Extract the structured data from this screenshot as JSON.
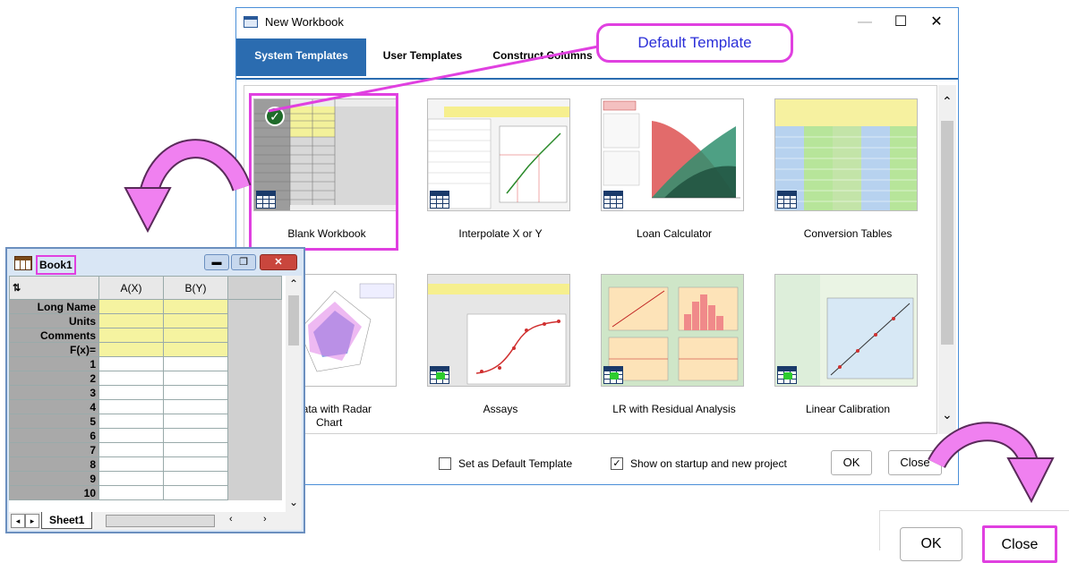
{
  "dialog": {
    "title": "New Workbook",
    "caption_minimize": "—",
    "caption_maximize": "☐",
    "caption_close": "✕",
    "tabs": [
      "System Templates",
      "User Templates",
      "Construct Columns"
    ],
    "templates": [
      {
        "label": "Blank Workbook"
      },
      {
        "label": "Interpolate X or Y"
      },
      {
        "label": "Loan Calculator"
      },
      {
        "label": "Conversion Tables"
      },
      {
        "label_line1": "e Data with Radar",
        "label_line2": "Chart"
      },
      {
        "label": "Assays"
      },
      {
        "label": "LR with Residual Analysis"
      },
      {
        "label": "Linear Calibration"
      }
    ],
    "footer": {
      "set_default_label": "Set as Default Template",
      "set_default_checked": false,
      "show_startup_label": "Show on startup and new project",
      "show_startup_checked": true,
      "ok_label": "OK",
      "close_label": "Close"
    }
  },
  "callout": {
    "text": "Default Template"
  },
  "book": {
    "name": "Book1",
    "columns": [
      "A(X)",
      "B(Y)"
    ],
    "header_rows": [
      "Long Name",
      "Units",
      "Comments",
      "F(x)="
    ],
    "data_rows": [
      "1",
      "2",
      "3",
      "4",
      "5",
      "6",
      "7",
      "8",
      "9",
      "10"
    ],
    "sheet_tab": "Sheet1"
  },
  "zoomed_buttons": {
    "ok_label": "OK",
    "close_label": "Close"
  },
  "colors": {
    "accent": "#2b6cb0",
    "highlight": "#e040e0",
    "callout_text": "#2b2fd8"
  }
}
